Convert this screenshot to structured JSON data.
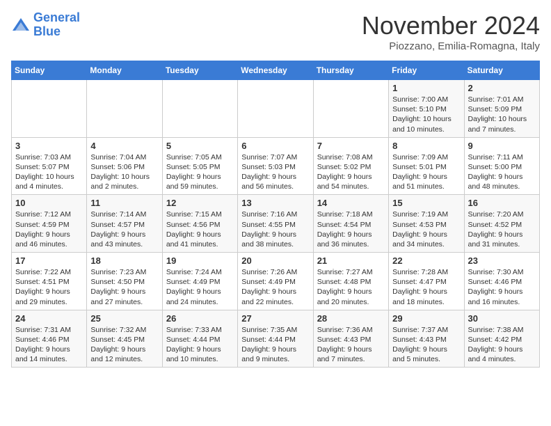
{
  "header": {
    "logo_line1": "General",
    "logo_line2": "Blue",
    "month_title": "November 2024",
    "location": "Piozzano, Emilia-Romagna, Italy"
  },
  "weekdays": [
    "Sunday",
    "Monday",
    "Tuesday",
    "Wednesday",
    "Thursday",
    "Friday",
    "Saturday"
  ],
  "weeks": [
    [
      {
        "day": "",
        "info": ""
      },
      {
        "day": "",
        "info": ""
      },
      {
        "day": "",
        "info": ""
      },
      {
        "day": "",
        "info": ""
      },
      {
        "day": "",
        "info": ""
      },
      {
        "day": "1",
        "info": "Sunrise: 7:00 AM\nSunset: 5:10 PM\nDaylight: 10 hours\nand 10 minutes."
      },
      {
        "day": "2",
        "info": "Sunrise: 7:01 AM\nSunset: 5:09 PM\nDaylight: 10 hours\nand 7 minutes."
      }
    ],
    [
      {
        "day": "3",
        "info": "Sunrise: 7:03 AM\nSunset: 5:07 PM\nDaylight: 10 hours\nand 4 minutes."
      },
      {
        "day": "4",
        "info": "Sunrise: 7:04 AM\nSunset: 5:06 PM\nDaylight: 10 hours\nand 2 minutes."
      },
      {
        "day": "5",
        "info": "Sunrise: 7:05 AM\nSunset: 5:05 PM\nDaylight: 9 hours\nand 59 minutes."
      },
      {
        "day": "6",
        "info": "Sunrise: 7:07 AM\nSunset: 5:03 PM\nDaylight: 9 hours\nand 56 minutes."
      },
      {
        "day": "7",
        "info": "Sunrise: 7:08 AM\nSunset: 5:02 PM\nDaylight: 9 hours\nand 54 minutes."
      },
      {
        "day": "8",
        "info": "Sunrise: 7:09 AM\nSunset: 5:01 PM\nDaylight: 9 hours\nand 51 minutes."
      },
      {
        "day": "9",
        "info": "Sunrise: 7:11 AM\nSunset: 5:00 PM\nDaylight: 9 hours\nand 48 minutes."
      }
    ],
    [
      {
        "day": "10",
        "info": "Sunrise: 7:12 AM\nSunset: 4:59 PM\nDaylight: 9 hours\nand 46 minutes."
      },
      {
        "day": "11",
        "info": "Sunrise: 7:14 AM\nSunset: 4:57 PM\nDaylight: 9 hours\nand 43 minutes."
      },
      {
        "day": "12",
        "info": "Sunrise: 7:15 AM\nSunset: 4:56 PM\nDaylight: 9 hours\nand 41 minutes."
      },
      {
        "day": "13",
        "info": "Sunrise: 7:16 AM\nSunset: 4:55 PM\nDaylight: 9 hours\nand 38 minutes."
      },
      {
        "day": "14",
        "info": "Sunrise: 7:18 AM\nSunset: 4:54 PM\nDaylight: 9 hours\nand 36 minutes."
      },
      {
        "day": "15",
        "info": "Sunrise: 7:19 AM\nSunset: 4:53 PM\nDaylight: 9 hours\nand 34 minutes."
      },
      {
        "day": "16",
        "info": "Sunrise: 7:20 AM\nSunset: 4:52 PM\nDaylight: 9 hours\nand 31 minutes."
      }
    ],
    [
      {
        "day": "17",
        "info": "Sunrise: 7:22 AM\nSunset: 4:51 PM\nDaylight: 9 hours\nand 29 minutes."
      },
      {
        "day": "18",
        "info": "Sunrise: 7:23 AM\nSunset: 4:50 PM\nDaylight: 9 hours\nand 27 minutes."
      },
      {
        "day": "19",
        "info": "Sunrise: 7:24 AM\nSunset: 4:49 PM\nDaylight: 9 hours\nand 24 minutes."
      },
      {
        "day": "20",
        "info": "Sunrise: 7:26 AM\nSunset: 4:49 PM\nDaylight: 9 hours\nand 22 minutes."
      },
      {
        "day": "21",
        "info": "Sunrise: 7:27 AM\nSunset: 4:48 PM\nDaylight: 9 hours\nand 20 minutes."
      },
      {
        "day": "22",
        "info": "Sunrise: 7:28 AM\nSunset: 4:47 PM\nDaylight: 9 hours\nand 18 minutes."
      },
      {
        "day": "23",
        "info": "Sunrise: 7:30 AM\nSunset: 4:46 PM\nDaylight: 9 hours\nand 16 minutes."
      }
    ],
    [
      {
        "day": "24",
        "info": "Sunrise: 7:31 AM\nSunset: 4:46 PM\nDaylight: 9 hours\nand 14 minutes."
      },
      {
        "day": "25",
        "info": "Sunrise: 7:32 AM\nSunset: 4:45 PM\nDaylight: 9 hours\nand 12 minutes."
      },
      {
        "day": "26",
        "info": "Sunrise: 7:33 AM\nSunset: 4:44 PM\nDaylight: 9 hours\nand 10 minutes."
      },
      {
        "day": "27",
        "info": "Sunrise: 7:35 AM\nSunset: 4:44 PM\nDaylight: 9 hours\nand 9 minutes."
      },
      {
        "day": "28",
        "info": "Sunrise: 7:36 AM\nSunset: 4:43 PM\nDaylight: 9 hours\nand 7 minutes."
      },
      {
        "day": "29",
        "info": "Sunrise: 7:37 AM\nSunset: 4:43 PM\nDaylight: 9 hours\nand 5 minutes."
      },
      {
        "day": "30",
        "info": "Sunrise: 7:38 AM\nSunset: 4:42 PM\nDaylight: 9 hours\nand 4 minutes."
      }
    ]
  ]
}
